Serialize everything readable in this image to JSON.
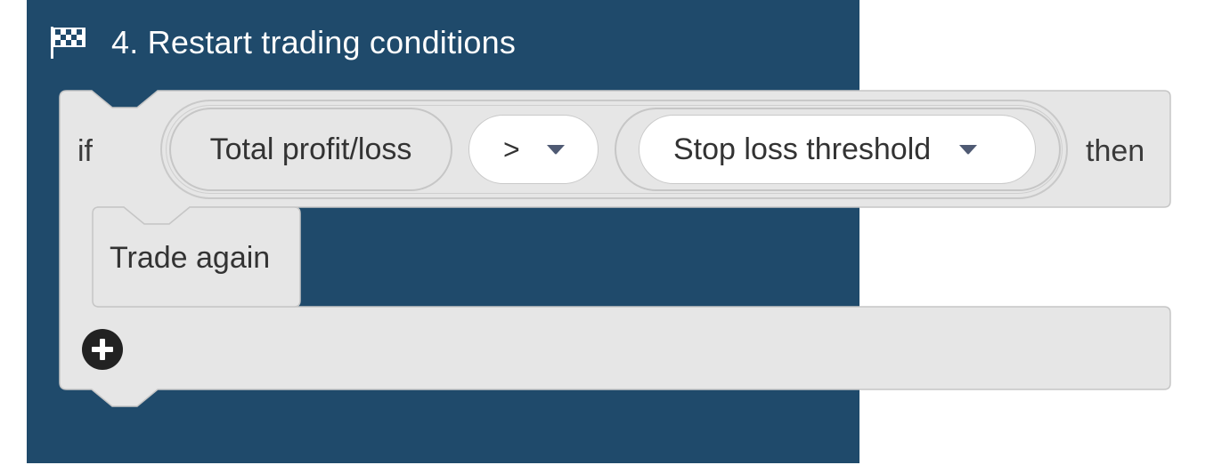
{
  "block": {
    "title": "4. Restart trading conditions",
    "icon": "checkered-flag-icon",
    "colors": {
      "header_bg": "#1f4a6b",
      "body_bg": "#e6e6e6",
      "border": "#c6c6c6"
    }
  },
  "condition": {
    "if_label": "if",
    "then_label": "then",
    "left_operand": "Total profit/loss",
    "operator": {
      "selected": ">"
    },
    "right_operand": {
      "selected": "Stop loss threshold"
    }
  },
  "statements": [
    {
      "label": "Trade again"
    }
  ],
  "add_button": {
    "icon": "plus-circle-icon"
  }
}
